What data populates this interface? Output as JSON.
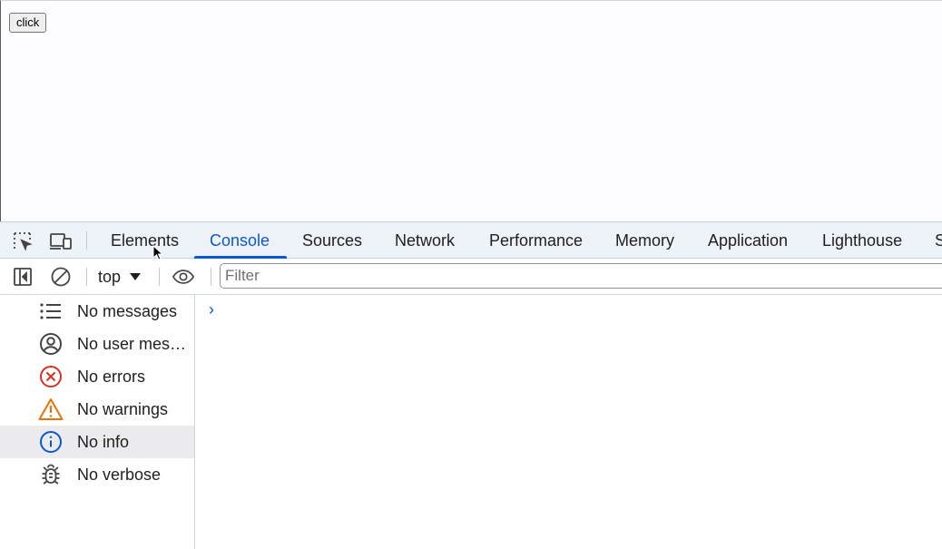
{
  "page": {
    "button_label": "click"
  },
  "devtools": {
    "tabs": [
      {
        "label": "Elements",
        "active": false
      },
      {
        "label": "Console",
        "active": true
      },
      {
        "label": "Sources",
        "active": false
      },
      {
        "label": "Network",
        "active": false
      },
      {
        "label": "Performance",
        "active": false
      },
      {
        "label": "Memory",
        "active": false
      },
      {
        "label": "Application",
        "active": false
      },
      {
        "label": "Lighthouse",
        "active": false
      },
      {
        "label": "S",
        "active": false
      }
    ],
    "toolbar": {
      "context": "top",
      "filter_placeholder": "Filter"
    },
    "sidebar": {
      "items": [
        {
          "label": "No messages",
          "icon": "list-icon"
        },
        {
          "label": "No user mess…",
          "icon": "user-icon"
        },
        {
          "label": "No errors",
          "icon": "error-icon"
        },
        {
          "label": "No warnings",
          "icon": "warning-icon"
        },
        {
          "label": "No info",
          "icon": "info-icon",
          "selected": true
        },
        {
          "label": "No verbose",
          "icon": "bug-icon"
        }
      ]
    },
    "console": {
      "prompt": "›"
    }
  },
  "colors": {
    "accent": "#0b57d0",
    "error": "#d93025",
    "warning": "#e8710a",
    "info": "#0b57d0"
  }
}
